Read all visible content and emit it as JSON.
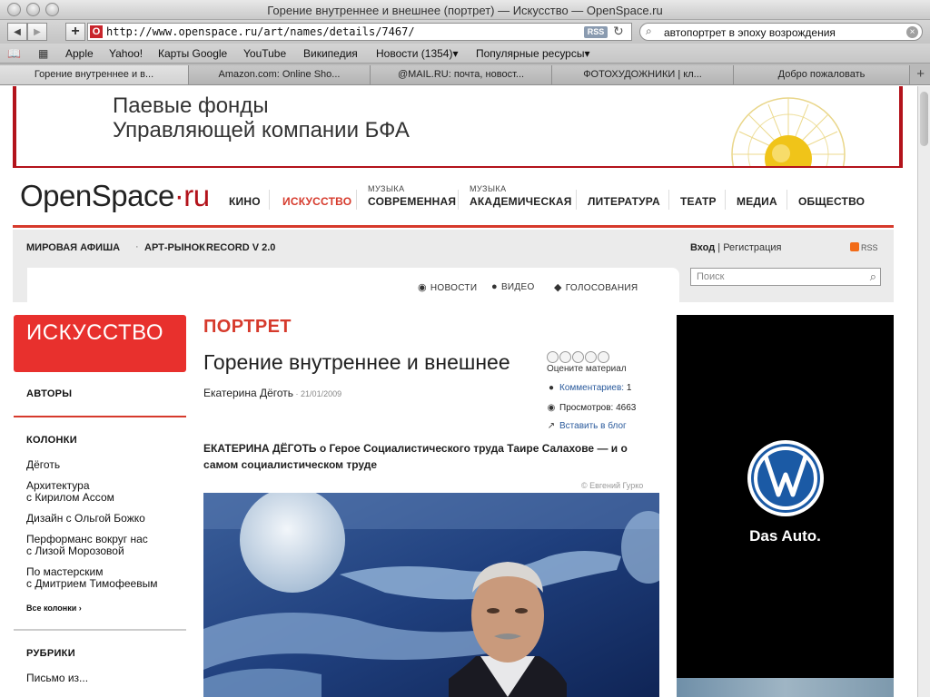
{
  "window": {
    "title": "Горение внутреннее и внешнее (портрет) — Искусство — OpenSpace.ru"
  },
  "toolbar": {
    "url": "http://www.openspace.ru/art/names/details/7467/",
    "favicon_letter": "O",
    "rss_label": "RSS",
    "search_query": "автопортрет в эпоху возрождения"
  },
  "bookmarks": {
    "items": [
      "Apple",
      "Yahoo!",
      "Карты Google",
      "YouTube",
      "Википедия",
      "Новости (1354)▾",
      "Популярные ресурсы▾"
    ]
  },
  "tabs": [
    {
      "label": "Горение внутреннее и в...",
      "active": true
    },
    {
      "label": "Amazon.com: Online Sho..."
    },
    {
      "label": "@MAIL.RU: почта, новост..."
    },
    {
      "label": "ФОТОХУДОЖНИКИ | кл..."
    },
    {
      "label": "Добро пожаловать"
    }
  ],
  "banner": {
    "line1": "Паевые фонды",
    "line2": "Управляющей компании БФА"
  },
  "site": {
    "logo_main": "OpenSpace",
    "logo_suffix": "·ru",
    "nav": [
      {
        "label": "КИНО"
      },
      {
        "label": "ИСКУССТВО",
        "active": true
      },
      {
        "label": "СОВРЕМЕННАЯ",
        "sup": "МУЗЫКА"
      },
      {
        "label": "АКАДЕМИЧЕСКАЯ",
        "sup": "МУЗЫКА"
      },
      {
        "label": "ЛИТЕРАТУРА"
      },
      {
        "label": "ТЕАТР"
      },
      {
        "label": "МЕДИА"
      },
      {
        "label": "ОБЩЕСТВО"
      }
    ],
    "accent_color": "#d63a2c"
  },
  "subbar": {
    "links": [
      "МИРОВАЯ АФИША",
      "АРТ-РЫНОК",
      "RECORD V 2.0"
    ],
    "separator": "·",
    "login": "Вход",
    "login_sep": " | ",
    "register": "Регистрация",
    "rss": "RSS",
    "features": [
      "НОВОСТИ",
      "ВИДЕО",
      "ГОЛОСОВАНИЯ"
    ],
    "search_placeholder": "Поиск"
  },
  "sidebar": {
    "section_title": "ИСКУССТВО",
    "authors": "АВТОРЫ",
    "columns_title": "КОЛОНКИ",
    "columns": [
      {
        "l1": "Дёготь"
      },
      {
        "l1": "Архитектура",
        "l2": "с Кирилом Ассом"
      },
      {
        "l1": "Дизайн с Ольгой Божко"
      },
      {
        "l1": "Перформанс вокруг нас",
        "l2": "с Лизой Морозовой"
      },
      {
        "l1": "По мастерским",
        "l2": "с Дмитрием Тимофеевым"
      }
    ],
    "all_columns": "Все колонки ›",
    "rubrics_title": "РУБРИКИ",
    "rubrics": [
      "Письмо из..."
    ]
  },
  "article": {
    "rubric": "ПОРТРЕТ",
    "title": "Горение внутреннее и внешнее",
    "author": "Екатерина Дёготь",
    "date": "21/01/2009",
    "rate_label": "Оцените материал",
    "rating_stars": 5,
    "comments_label": "Комментариев:",
    "comments_count": "1",
    "views_label": "Просмотров:",
    "views_count": "4663",
    "blog_label": "Вставить в блог",
    "lead": "ЕКАТЕРИНА ДЁГОТЬ о Герое Социалистического труда Таире Салахове — и о самом социалистическом труде",
    "photo_credit": "©   Евгений Гурко"
  },
  "ad": {
    "slogan": "Das Auto.",
    "brand_color": "#1b5aa5"
  }
}
